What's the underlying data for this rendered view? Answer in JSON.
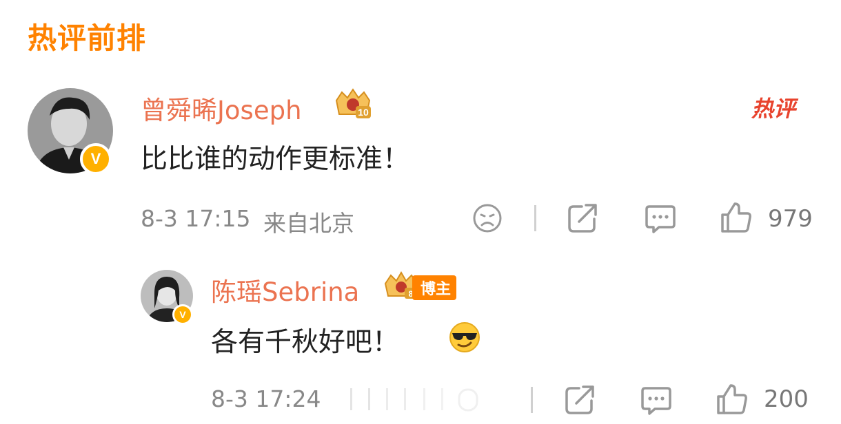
{
  "section_title": "热评前排",
  "comments": [
    {
      "name": "曾舜晞Joseph",
      "level": "10",
      "text": "比比谁的动作更标准！",
      "hot_tag": "热评",
      "time": "8-3 17:15",
      "location": "来自北京",
      "likes": "979",
      "verified_badge": "V"
    }
  ],
  "reply": {
    "name": "陈瑶Sebrina",
    "level": "8",
    "role_tag": "博主",
    "text": "各有千秋好吧！",
    "time": "8-3 17:24",
    "likes": "200",
    "verified_badge": "V"
  },
  "icons": {
    "dislike": "sad-face-icon",
    "share": "share-icon",
    "comment": "comment-icon",
    "like": "thumbs-up-icon",
    "emoji": "sunglasses-emoji"
  },
  "colors": {
    "accent": "#ff8200",
    "username": "#eb7350",
    "hot": "#e8432d",
    "meta": "#888888"
  }
}
